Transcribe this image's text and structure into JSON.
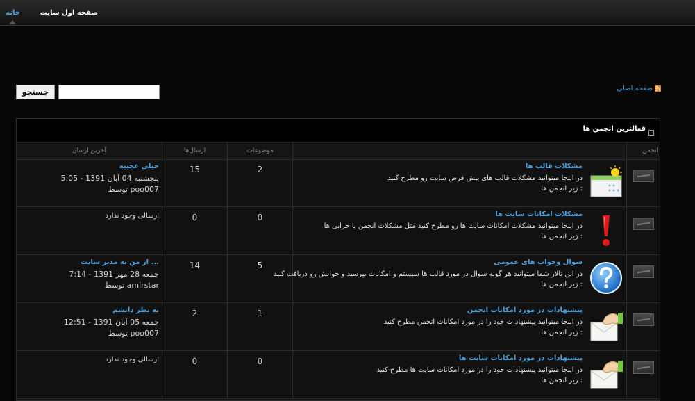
{
  "nav": {
    "home_label": "خانه",
    "first_page_label": "صفحه اول سایت"
  },
  "search": {
    "button_label": "جستجو",
    "value": ""
  },
  "home_link": {
    "label": "صفحه اصلی",
    "icon": "rss-icon"
  },
  "forum_box": {
    "title": "فعالترین انجمن ها",
    "columns": {
      "forum": "انجمن",
      "topics": "موضوعات",
      "posts": "ارسال‌ها",
      "last_post": "آخرین ارسال"
    },
    "rows": [
      {
        "name": "مشکلات قالب ها",
        "description": "در اینجا میتوانید مشکلات قالب های پیش فرض سایت رو مطرح کنید",
        "subforums": "زیر انجمن ها :",
        "icon": "calendar-sun-icon",
        "topics": "2",
        "posts": "15",
        "last_title": "خیلی عجیبه",
        "last_date": "پنجشنبه 04 آبان 1391 - 5:05",
        "by_label": "توسط",
        "last_user": "poo007",
        "no_post": ""
      },
      {
        "name": "مشکلات امکانات سایت ها",
        "description": "در اینجا میتوانید مشکلات امکانات سایت ها رو مطرح کنید مثل مشکلات انجمن یا خرابی ها",
        "subforums": "زیر انجمن ها :",
        "icon": "exclamation-icon",
        "topics": "0",
        "posts": "0",
        "last_title": "",
        "last_date": "",
        "by_label": "",
        "last_user": "",
        "no_post": "ارسالی وجود ندارد"
      },
      {
        "name": "سوال وجواب های عمومی",
        "description": "در این تالار شما میتوانید هر گونه سوال در مورد قالب ها سیستم و امکانات بپرسید و جوابش رو دریافت کنید",
        "subforums": "زیر انجمن ها :",
        "icon": "question-icon",
        "topics": "5",
        "posts": "14",
        "last_title": "از من به مدیر سایت ...",
        "last_date": "جمعه 28 مهر 1391 - 7:14",
        "by_label": "توسط",
        "last_user": "amirstar",
        "no_post": ""
      },
      {
        "name": "پیشنهادات در مورد امکانات انجمن",
        "description": "در اینجا میتوانید پیشنهادات خود را در مورد امکانات انجمن مطرح کنید",
        "subforums": "زیر انجمن ها :",
        "icon": "envelope-hand-icon",
        "topics": "1",
        "posts": "2",
        "last_title": "به نظر دانشم",
        "last_date": "جمعه 05 آبان 1391 - 12:51",
        "by_label": "توسط",
        "last_user": "poo007",
        "no_post": ""
      },
      {
        "name": "پیشنهادات در مورد امکانات سایت ها",
        "description": "در اینجا میتوانید پیشنهادات خود را در مورد امکانات سایت ها مطرح کنید",
        "subforums": "زیر انجمن ها :",
        "icon": "envelope-hand-icon",
        "topics": "0",
        "posts": "0",
        "last_title": "",
        "last_date": "",
        "by_label": "",
        "last_user": "",
        "no_post": "ارسالی وجود ندارد"
      }
    ]
  }
}
